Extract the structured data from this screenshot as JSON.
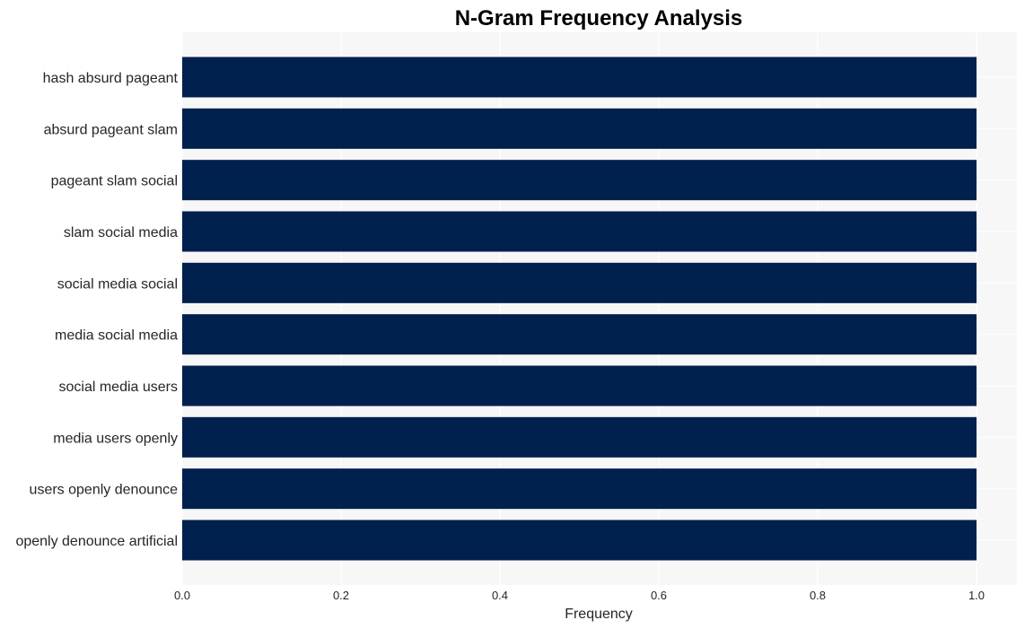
{
  "chart_data": {
    "type": "bar",
    "orientation": "horizontal",
    "title": "N-Gram Frequency Analysis",
    "xlabel": "Frequency",
    "ylabel": "",
    "categories": [
      "hash absurd pageant",
      "absurd pageant slam",
      "pageant slam social",
      "slam social media",
      "social media social",
      "media social media",
      "social media users",
      "media users openly",
      "users openly denounce",
      "openly denounce artificial"
    ],
    "values": [
      1,
      1,
      1,
      1,
      1,
      1,
      1,
      1,
      1,
      1
    ],
    "xlim": [
      0,
      1.05
    ],
    "xticks": [
      0.0,
      0.2,
      0.4,
      0.6,
      0.8,
      1.0
    ],
    "xtick_labels": [
      "0.0",
      "0.2",
      "0.4",
      "0.6",
      "0.8",
      "1.0"
    ],
    "grid": true,
    "legend": "none",
    "colors": {
      "bar": "#00204e",
      "plot_background": "#f7f7f7",
      "grid": "#ffffff",
      "text": "#262626"
    }
  }
}
